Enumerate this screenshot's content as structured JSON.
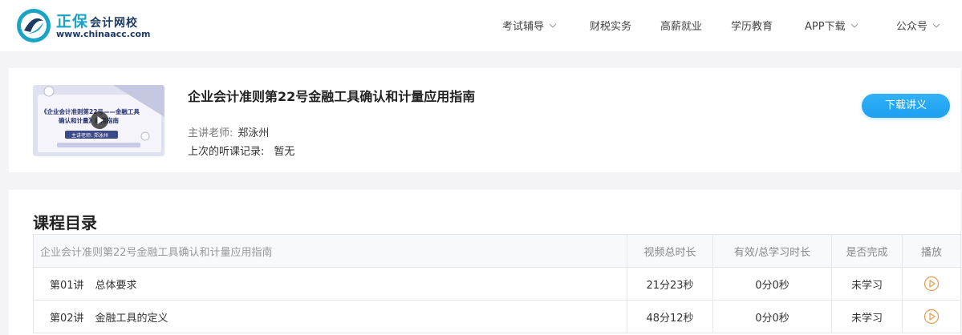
{
  "brand": {
    "name_cn": "正保",
    "name_cn_sub": "会计网校",
    "domain": "www.chinaacc.com",
    "colors": {
      "teal": "#1aa3c4",
      "navy": "#1d3b63"
    }
  },
  "nav": {
    "items": [
      {
        "label": "考试辅导",
        "has_dropdown": true
      },
      {
        "label": "财税实务",
        "has_dropdown": false
      },
      {
        "label": "高薪就业",
        "has_dropdown": false
      },
      {
        "label": "学历教育",
        "has_dropdown": false
      },
      {
        "label": "APP下载",
        "has_dropdown": true
      },
      {
        "label": "公众号",
        "has_dropdown": true
      }
    ],
    "chevron_icon": "chevron-down-icon"
  },
  "course": {
    "title": "企业会计准则第22号金融工具确认和计量应用指南",
    "teacher_label": "主讲老师:",
    "teacher": "郑泳州",
    "last_record_label": "上次的听课记录:",
    "last_record": "暂无",
    "download_button": "下载讲义",
    "thumbnail": {
      "line1": "《企业会计准则第22号——金融工具",
      "line2": "确认和计量》应用指南",
      "teacher_tag": "主讲老师:  郑泳州",
      "play_icon": "play-circle-icon"
    }
  },
  "catalog": {
    "heading": "课程目录",
    "columns": {
      "name": "企业会计准则第22号金融工具确认和计量应用指南",
      "duration": "视频总时长",
      "study_time": "有效/总学习时长",
      "completed": "是否完成",
      "play": "播放"
    },
    "lessons": [
      {
        "num": "第01讲",
        "title": "总体要求",
        "duration": "21分23秒",
        "study_time": "0分0秒",
        "status": "未学习"
      },
      {
        "num": "第02讲",
        "title": "金融工具的定义",
        "duration": "48分12秒",
        "study_time": "0分0秒",
        "status": "未学习"
      }
    ],
    "status_color": "#3cb34a",
    "play_icon_color": "#e69a4d"
  }
}
